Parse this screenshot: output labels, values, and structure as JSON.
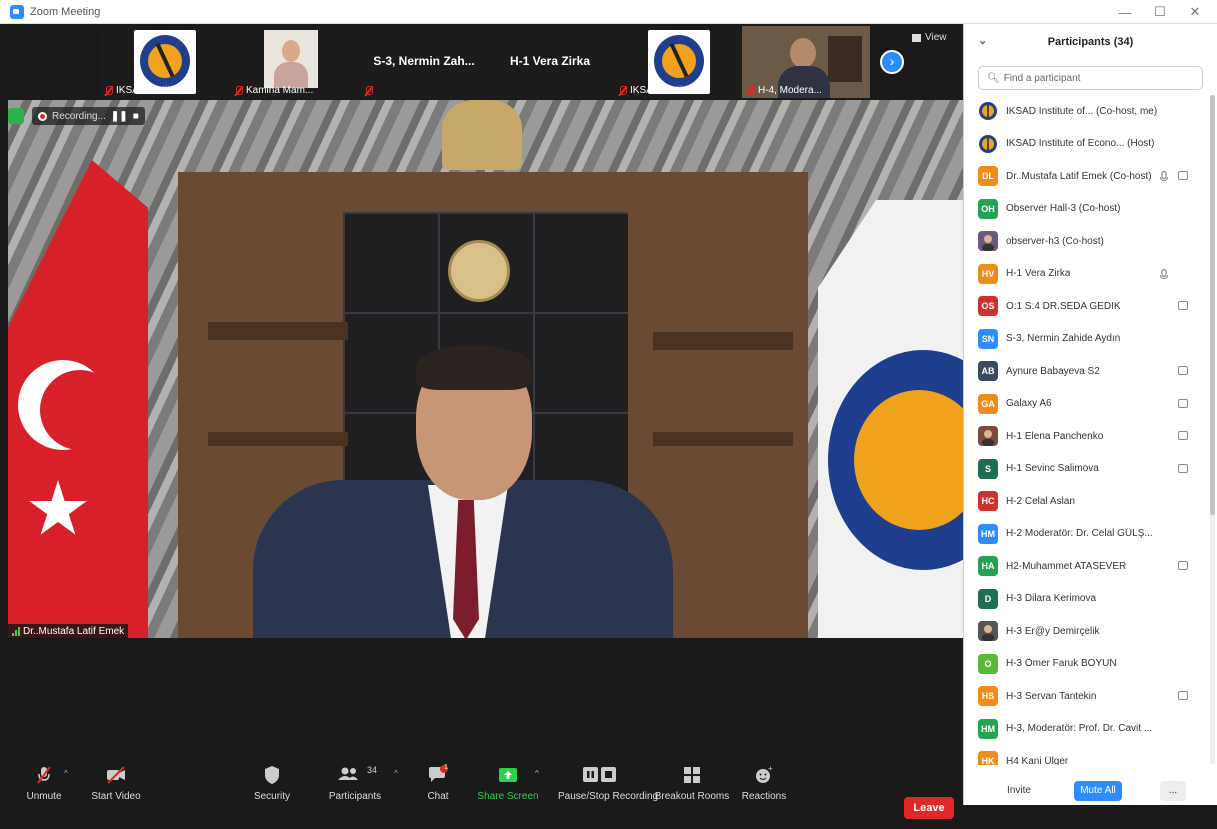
{
  "window": {
    "title": "Zoom Meeting"
  },
  "thumbnails": [
    {
      "name": "IKSAD Institut...",
      "type": "logo"
    },
    {
      "name": "Kamina Mam...",
      "type": "video"
    },
    {
      "name": "",
      "title": "S-3, Nermin Zah...",
      "type": "name"
    },
    {
      "name": "",
      "title": "H-1 Vera Zirka",
      "type": "name"
    },
    {
      "name": "IKSAD Institut...",
      "type": "logo"
    },
    {
      "name": "H-4, Modera...",
      "type": "video"
    }
  ],
  "view_label": "View",
  "recording": {
    "label": "Recording..."
  },
  "speaker": {
    "name": "Dr..Mustafa Latif Emek"
  },
  "toolbar": {
    "unmute": "Unmute",
    "start_video": "Start Video",
    "security": "Security",
    "participants": "Participants",
    "participants_count": "34",
    "chat": "Chat",
    "chat_badge": "1",
    "share_screen": "Share Screen",
    "pause_recording": "Pause/Stop Recording",
    "breakout_rooms": "Breakout Rooms",
    "reactions": "Reactions",
    "leave": "Leave"
  },
  "panel": {
    "title": "Participants (34)",
    "search_placeholder": "Find a participant",
    "invite": "Invite",
    "mute_all": "Mute All",
    "more": "..."
  },
  "participants": [
    {
      "initials": "",
      "color": "#ffffff",
      "avatar": "logo",
      "name": "IKSAD Institute of... (Co-host, me)",
      "mic": "off",
      "cam": "off"
    },
    {
      "initials": "",
      "color": "#ffffff",
      "avatar": "logo",
      "name": "IKSAD Institute of Econo... (Host)",
      "mic": "off",
      "cam": "off"
    },
    {
      "initials": "DL",
      "color": "#f08c1c",
      "name": "Dr..Mustafa Latif Emek (Co-host)",
      "mic": "on",
      "cam": "on"
    },
    {
      "initials": "OH",
      "color": "#23a455",
      "name": "Observer Hall-3 (Co-host)",
      "mic": "off",
      "cam": "off"
    },
    {
      "initials": "",
      "color": "#6c5a7c",
      "avatar": "photo",
      "name": "observer-h3 (Co-host)",
      "mic": "off",
      "cam": "off"
    },
    {
      "initials": "HV",
      "color": "#f08c1c",
      "name": "H-1 Vera Zirka",
      "mic": "on",
      "cam": "off"
    },
    {
      "initials": "OS",
      "color": "#d0312d",
      "name": "O:1 S:4 DR.SEDA GEDİK",
      "mic": "off",
      "cam": "on"
    },
    {
      "initials": "SN",
      "color": "#2d8cff",
      "name": "S-3, Nermin Zahide Aydın",
      "mic": "off",
      "cam": "off"
    },
    {
      "initials": "AB",
      "color": "#3a4a63",
      "name": "Aynure Babayeva S2",
      "mic": "off",
      "cam": "on"
    },
    {
      "initials": "GA",
      "color": "#f08c1c",
      "name": "Galaxy A6",
      "mic": "off",
      "cam": "on"
    },
    {
      "initials": "",
      "color": "#7a4b3a",
      "avatar": "photo",
      "name": "H-1 Elena Panchenko",
      "mic": "off",
      "cam": "on"
    },
    {
      "initials": "S",
      "color": "#1e6f54",
      "name": "H-1 Sevinc Salimova",
      "mic": "off",
      "cam": "on"
    },
    {
      "initials": "HC",
      "color": "#d0312d",
      "name": "H-2 Celal Aslan",
      "mic": "off",
      "cam": "off"
    },
    {
      "initials": "HM",
      "color": "#2d8cff",
      "name": "H-2 Moderatör: Dr. Celal GÜLŞ...",
      "mic": "off",
      "cam": "off"
    },
    {
      "initials": "HA",
      "color": "#23a455",
      "name": "H2-Muhammet ATASEVER",
      "mic": "off",
      "cam": "on"
    },
    {
      "initials": "D",
      "color": "#1e6f54",
      "name": "H-3 Dilara Kerimova",
      "mic": "off",
      "cam": "off"
    },
    {
      "initials": "",
      "color": "#555555",
      "avatar": "photo",
      "name": "H-3 Er@y Demirçelik",
      "mic": "off",
      "cam": "off"
    },
    {
      "initials": "O",
      "color": "#5cb83a",
      "name": "H-3 Ömer Faruk BOYUN",
      "mic": "off",
      "cam": "off"
    },
    {
      "initials": "HS",
      "color": "#f08c1c",
      "name": "H-3 Servan Tantekin",
      "mic": "off",
      "cam": "on"
    },
    {
      "initials": "HM",
      "color": "#23a455",
      "name": "H-3, Moderatör: Prof. Dr. Cavit ...",
      "mic": "off",
      "cam": "off"
    },
    {
      "initials": "HK",
      "color": "#f08c1c",
      "name": "H4 Kani Ülger",
      "mic": "off",
      "cam": "off"
    }
  ]
}
